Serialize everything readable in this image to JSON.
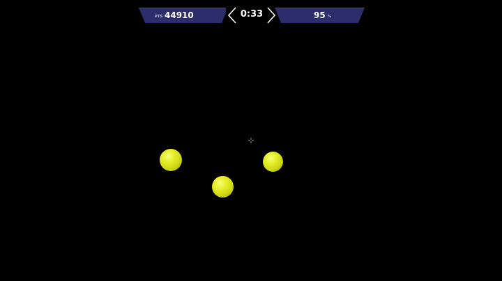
{
  "hud": {
    "score_label": "PTS",
    "score": "44910",
    "timer": "0:33",
    "accuracy": "95",
    "accuracy_unit": "%"
  },
  "colors": {
    "hud_panel": "#2d2d6b",
    "target": "#e6ef2a",
    "background": "#000000"
  },
  "icons": {
    "crosshair": "crosshair-icon",
    "timer_left": "chevron-left-icon",
    "timer_right": "chevron-right-icon"
  },
  "targets": [
    {
      "name": "target-1"
    },
    {
      "name": "target-2"
    },
    {
      "name": "target-3"
    }
  ]
}
